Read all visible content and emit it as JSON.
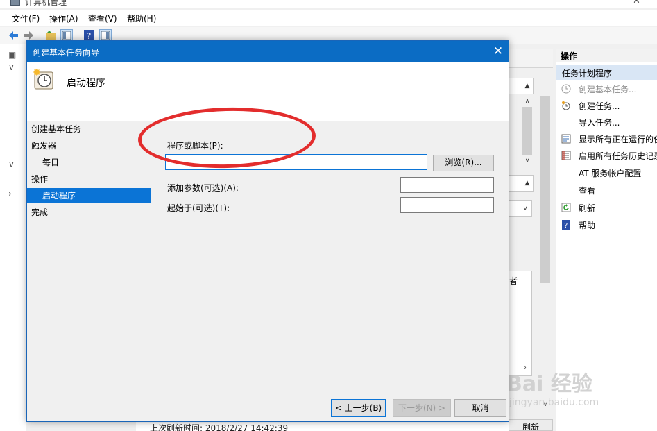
{
  "window": {
    "title": "计算机管理"
  },
  "menubar": {
    "items": [
      "文件(F)",
      "操作(A)",
      "查看(V)",
      "帮助(H)"
    ]
  },
  "status": {
    "last_refresh": "上次刷新时间: 2018/2/27 14:42:39",
    "refresh_button": "刷新",
    "partial_text": "者"
  },
  "actions": {
    "header": "操作",
    "section": "任务计划程序",
    "items": [
      {
        "label": "创建基本任务...",
        "icon": "task-wizard-icon",
        "enabled": false
      },
      {
        "label": "创建任务...",
        "icon": "create-task-icon",
        "enabled": true
      },
      {
        "label": "导入任务...",
        "icon": "",
        "enabled": true
      },
      {
        "label": "显示所有正在运行的任务",
        "icon": "running-tasks-icon",
        "enabled": true
      },
      {
        "label": "启用所有任务历史记录",
        "icon": "history-icon",
        "enabled": true
      },
      {
        "label": "AT 服务帐户配置",
        "icon": "",
        "enabled": true
      },
      {
        "label": "查看",
        "icon": "",
        "enabled": true
      },
      {
        "label": "刷新",
        "icon": "refresh-icon",
        "enabled": true
      },
      {
        "label": "帮助",
        "icon": "help-icon",
        "enabled": true
      }
    ]
  },
  "dialog": {
    "title": "创建基本任务向导",
    "close_glyph": "✕",
    "page_title": "启动程序",
    "steps": [
      {
        "label": "创建基本任务",
        "level": 0,
        "current": false
      },
      {
        "label": "触发器",
        "level": 0,
        "current": false
      },
      {
        "label": "每日",
        "level": 1,
        "current": false
      },
      {
        "label": "操作",
        "level": 0,
        "current": false
      },
      {
        "label": "启动程序",
        "level": 1,
        "current": true
      },
      {
        "label": "完成",
        "level": 0,
        "current": false
      }
    ],
    "program_label": "程序或脚本(P):",
    "program_value": "",
    "browse_button": "浏览(R)...",
    "args_label": "添加参数(可选)(A):",
    "args_value": "",
    "start_in_label": "起始于(可选)(T):",
    "start_in_value": "",
    "back_button": "< 上一步(B)",
    "next_button": "下一步(N) >",
    "cancel_button": "取消"
  },
  "watermark": {
    "line1": "Bai 经验",
    "line2": "jingyan.baidu.com"
  },
  "colors": {
    "dialog_title": "#0b6cc4",
    "selection": "#0b74d6",
    "annotation": "#e32d2d",
    "actions_section": "#d9e6f5"
  }
}
